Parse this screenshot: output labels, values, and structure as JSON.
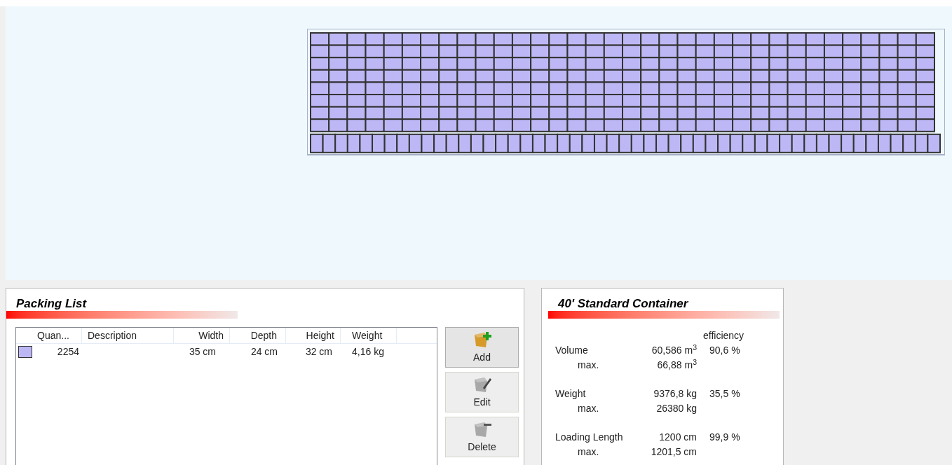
{
  "packing_list": {
    "title": "Packing List",
    "columns": [
      "Quan...",
      "Description",
      "Width",
      "Depth",
      "Height",
      "Weight"
    ],
    "rows": [
      {
        "color": "#bdb8f5",
        "cells": [
          "2254",
          "",
          "35 cm",
          "24 cm",
          "32 cm",
          "4,16 kg"
        ]
      }
    ],
    "buttons": [
      {
        "kind": "add",
        "label": "Add"
      },
      {
        "kind": "edit",
        "label": "Edit"
      },
      {
        "kind": "delete",
        "label": "Delete"
      }
    ]
  },
  "container": {
    "title": "40' Standard Container",
    "efficiency_heading": "efficiency",
    "metrics": [
      {
        "label": "Volume",
        "value": "60,586 m$^{3}$",
        "efficiency": "90,6 %",
        "max_label": "max.",
        "max": "66,88 m$^{3}$"
      },
      {
        "label": "Weight",
        "value": "9376,8 kg",
        "efficiency": "35,5 %",
        "max_label": "max.",
        "max": "26380 kg"
      },
      {
        "label": "Loading Length",
        "value": "1200 cm",
        "efficiency": "99,9 %",
        "max_label": "max.",
        "max": "1201,5 cm"
      }
    ]
  }
}
